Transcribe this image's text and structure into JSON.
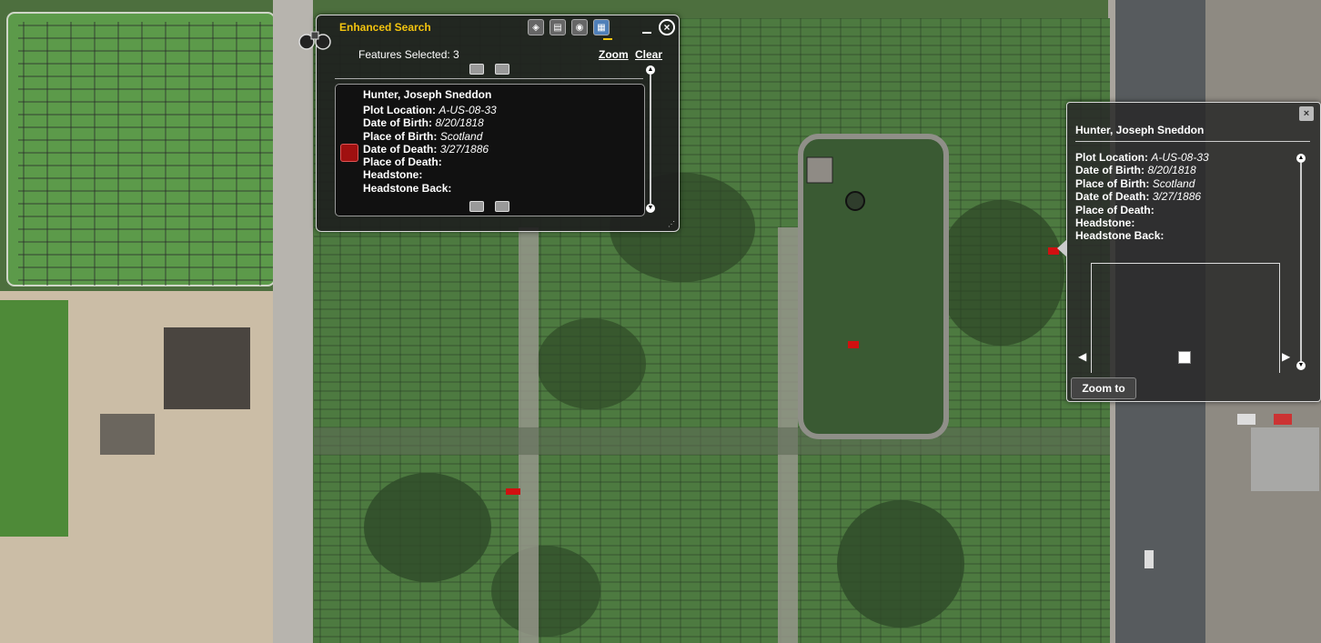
{
  "search_panel": {
    "title": "Enhanced Search",
    "tool_icons": [
      "search-by-shape-icon",
      "search-by-attribute-icon",
      "search-by-spatial-icon",
      "results-table-icon"
    ],
    "features_selected": "Features Selected: 3",
    "zoom_label": "Zoom",
    "clear_label": "Clear",
    "result": {
      "name": "Hunter, Joseph Sneddon",
      "plot_location_label": "Plot Location:",
      "plot_location": "A-US-08-33",
      "dob_label": "Date of Birth:",
      "dob": "8/20/1818",
      "pob_label": "Place of Birth:",
      "pob": "Scotland",
      "dod_label": "Date of Death:",
      "dod": "3/27/1886",
      "pod_label": "Place of Death:",
      "headstone_label": "Headstone:",
      "headstone_back_label": "Headstone Back:",
      "swatch_color": "#a01010"
    }
  },
  "popup": {
    "name": "Hunter, Joseph Sneddon",
    "plot_location_label": "Plot Location:",
    "plot_location": "A-US-08-33",
    "dob_label": "Date of Birth:",
    "dob": "8/20/1818",
    "pob_label": "Place of Birth:",
    "pob": "Scotland",
    "dod_label": "Date of Death:",
    "dod": "3/27/1886",
    "pod_label": "Place of Death:",
    "headstone_label": "Headstone:",
    "headstone_back_label": "Headstone Back:",
    "zoom_to_label": "Zoom to"
  },
  "colors": {
    "accent": "#f3c40f",
    "highlight": "#d01010",
    "grass": "#4a7a3c"
  }
}
